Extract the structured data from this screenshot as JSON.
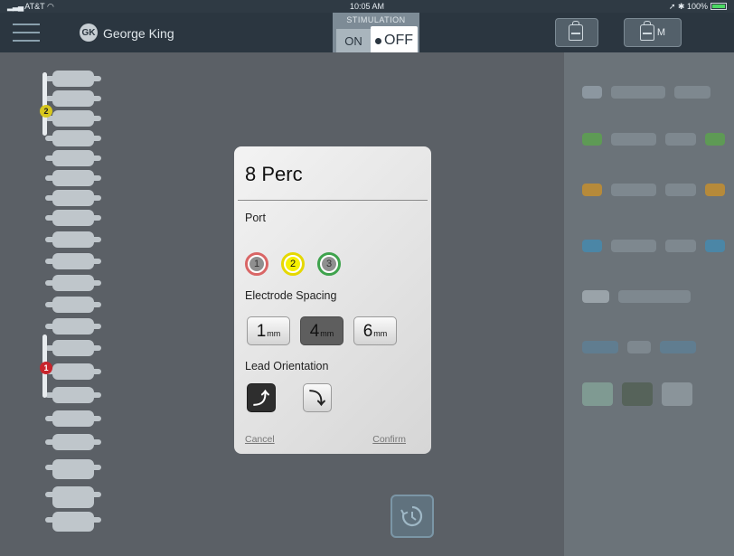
{
  "status_bar": {
    "carrier": "AT&T",
    "time": "10:05 AM",
    "battery": "100%"
  },
  "header": {
    "user_initials": "GK",
    "user_name": "George King",
    "stimulation": {
      "label": "STIMULATION",
      "on_label": "ON",
      "off_label": "OFF",
      "state": "OFF"
    },
    "device_buttons": [
      {
        "label": ""
      },
      {
        "label": "M"
      }
    ]
  },
  "spine": {
    "leads": [
      {
        "number": "2",
        "color": "#d8c81e"
      },
      {
        "number": "1",
        "color": "#c8252c"
      }
    ]
  },
  "modal": {
    "title": "8 Perc",
    "port_label": "Port",
    "ports": [
      {
        "number": "1",
        "border": "#d96666",
        "fill": "#8f8f8f",
        "selected": false
      },
      {
        "number": "2",
        "border": "#e5d800",
        "fill": "#f5f000",
        "selected": true
      },
      {
        "number": "3",
        "border": "#3fa34d",
        "fill": "#8f8f8f",
        "selected": false
      }
    ],
    "spacing_label": "Electrode Spacing",
    "spacing_options": [
      {
        "value": "1",
        "unit": "mm",
        "selected": false
      },
      {
        "value": "4",
        "unit": "mm",
        "selected": true
      },
      {
        "value": "6",
        "unit": "mm",
        "selected": false
      }
    ],
    "orientation_label": "Lead Orientation",
    "orientations": [
      {
        "icon": "arrow-up-right-icon",
        "glyph": "⤴",
        "selected": true
      },
      {
        "icon": "arrow-down-left-icon",
        "glyph": "⤵",
        "selected": false
      }
    ],
    "cancel_label": "Cancel",
    "confirm_label": "Confirm"
  },
  "history_button": {
    "icon": "history-icon"
  }
}
